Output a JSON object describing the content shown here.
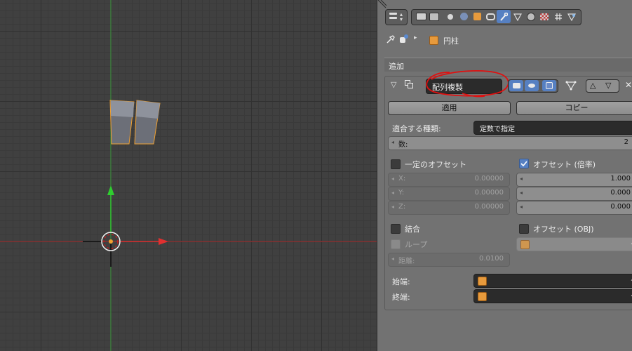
{
  "toolbar": {
    "tabs": [
      "render",
      "render-layers",
      "scene",
      "world",
      "object",
      "constraints",
      "modifiers",
      "data",
      "material",
      "texture",
      "particles",
      "physics"
    ],
    "active_tab": "modifiers"
  },
  "context": {
    "pin_icon": "pin-icon",
    "object_icon": "mesh-cube-icon",
    "object_name": "円柱"
  },
  "panel": {
    "add_label": "追加"
  },
  "modifier": {
    "name": "配列複製",
    "apply_label": "適用",
    "copy_label": "コピー",
    "fit_type_label": "適合する種類:",
    "fit_type_value": "定数で指定",
    "count_label": "数:",
    "count_value": "2",
    "constant_offset_label": "一定のオフセット",
    "constant_offset_checked": false,
    "relative_offset_label": "オフセット (倍率)",
    "relative_offset_checked": true,
    "const_x_label": "X:",
    "const_x_value": "0.00000",
    "const_y_label": "Y:",
    "const_y_value": "0.00000",
    "const_z_label": "Z:",
    "const_z_value": "0.00000",
    "rel_x_value": "1.000",
    "rel_y_value": "0.000",
    "rel_z_value": "0.000",
    "merge_label": "結合",
    "merge_checked": false,
    "object_offset_label": "オフセット (OBJ)",
    "object_offset_checked": false,
    "loop_label": "ループ",
    "distance_label": "距離:",
    "distance_value": "0.0100",
    "start_cap_label": "始端:",
    "end_cap_label": "終端:"
  },
  "colors": {
    "accent": "#5680c2",
    "selection_outline": "#f0a030",
    "x_axis": "#c83232",
    "y_axis": "#3cc83c",
    "annotation": "#e01010"
  }
}
